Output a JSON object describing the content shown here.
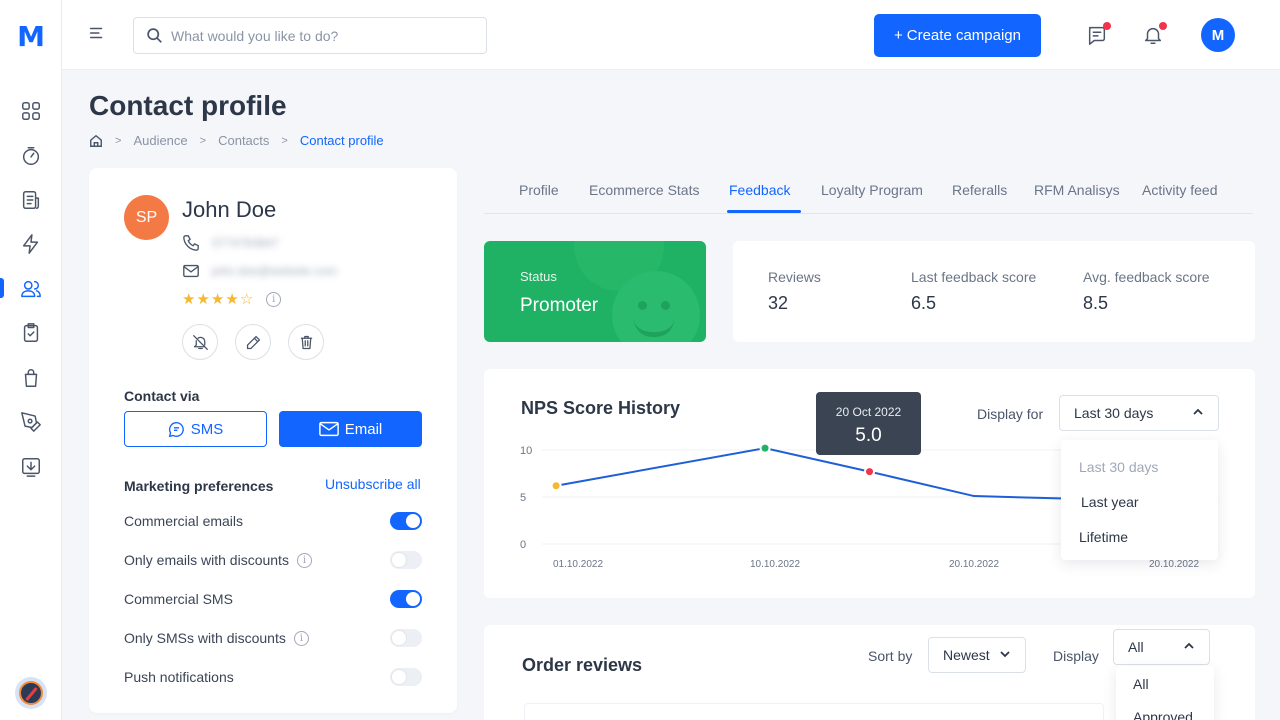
{
  "app": {
    "logo": "M",
    "user_initial": "M"
  },
  "search": {
    "placeholder": "What would you like to do?"
  },
  "toolbar": {
    "create_label": "Create campaign",
    "create_prefix": "+"
  },
  "page": {
    "title": "Contact profile"
  },
  "breadcrumb": {
    "items": [
      "Audience",
      "Contacts",
      "Contact profile"
    ]
  },
  "contact": {
    "initials": "SP",
    "name": "John Doe",
    "phone": "0774763847",
    "email": "john.doe@website.com",
    "rating": 4,
    "rating_max": 5
  },
  "contact_via": {
    "label": "Contact via",
    "sms_label": "SMS",
    "email_label": "Email"
  },
  "marketing": {
    "label": "Marketing preferences",
    "unsubscribe_label": "Unsubscribe all",
    "items": [
      {
        "label": "Commercial emails",
        "enabled": true,
        "info": false
      },
      {
        "label": "Only emails with discounts",
        "enabled": false,
        "info": true
      },
      {
        "label": "Commercial SMS",
        "enabled": true,
        "info": false
      },
      {
        "label": "Only SMSs with discounts",
        "enabled": false,
        "info": true
      },
      {
        "label": "Push notifications",
        "enabled": false,
        "info": false
      }
    ]
  },
  "tabs": [
    "Profile",
    "Ecommerce Stats",
    "Feedback",
    "Loyalty Program",
    "Referalls",
    "RFM Analisys",
    "Activity feed"
  ],
  "active_tab": "Feedback",
  "status": {
    "label": "Status",
    "value": "Promoter",
    "color": "#1fb164"
  },
  "stats": [
    {
      "label": "Reviews",
      "value": "32"
    },
    {
      "label": "Last feedback score",
      "value": "6.5"
    },
    {
      "label": "Avg. feedback score",
      "value": "8.5"
    }
  ],
  "nps": {
    "title": "NPS Score History",
    "display_for_label": "Display for",
    "selected_range": "Last 30 days",
    "range_options": [
      "Last 30 days",
      "Last year",
      "Lifetime"
    ],
    "tooltip": {
      "date": "20 Oct 2022",
      "value": "5.0"
    }
  },
  "chart_data": {
    "type": "line",
    "x": [
      "2022-09-30",
      "2022-10-10",
      "2022-10-15",
      "2022-10-20",
      "2022-10-25"
    ],
    "values": [
      6.2,
      10.2,
      7.7,
      5.1,
      4.8
    ],
    "xticks": [
      "01.10.2022",
      "10.10.2022",
      "20.10.2022",
      "20.10.2022"
    ],
    "yticks": [
      "0",
      "5",
      "10"
    ],
    "ylim": [
      0,
      10
    ],
    "line_color": "#1e5fd8",
    "point_colors": [
      "#f5b82e",
      "#1fb164",
      "#f0344b"
    ],
    "grid": true
  },
  "orders": {
    "title": "Order reviews",
    "sort_label": "Sort by",
    "sort_value": "Newest",
    "display_label": "Display",
    "display_value": "All",
    "display_options": [
      "All",
      "Approved"
    ]
  },
  "colors": {
    "accent": "#1266ff",
    "avatar": "#f47a45",
    "notification": "#f0344b"
  }
}
